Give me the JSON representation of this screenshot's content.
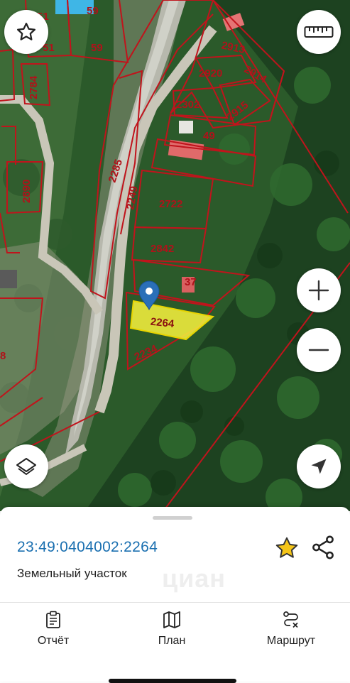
{
  "map": {
    "plot_labels": {
      "p51a": "51",
      "p59a": "59",
      "p51b": "51",
      "p59b": "59",
      "p2784": "2784",
      "p2913": "2913",
      "p2920": "2920",
      "p2914": "2914",
      "p2302": "2302",
      "p2915": "2915",
      "p49": "49",
      "p2285": "2285",
      "p2249": "2249",
      "p2890": "2890",
      "p2722": "2722",
      "p2842": "2842",
      "p37": "37",
      "p2264": "2264",
      "p2234": "2234",
      "p8": "8"
    },
    "controls": {
      "favorite_icon": "star-icon",
      "ruler_icon": "ruler-icon",
      "zoom_in_icon": "plus-icon",
      "zoom_out_icon": "minus-icon",
      "layers_icon": "layers-icon",
      "locate_icon": "location-arrow-icon"
    },
    "colors": {
      "boundary": "#c0141c",
      "selected_fill": "#f3ee3c",
      "marker": "#2a6fb8"
    }
  },
  "sheet": {
    "cadastral_number": "23:49:0404002:2264",
    "object_type": "Земельный участок",
    "watermark": "циан",
    "favorite_color": "#f5c518"
  },
  "tabs": [
    {
      "label": "Отчёт",
      "icon": "clipboard-icon"
    },
    {
      "label": "План",
      "icon": "map-icon"
    },
    {
      "label": "Маршрут",
      "icon": "route-icon"
    }
  ]
}
